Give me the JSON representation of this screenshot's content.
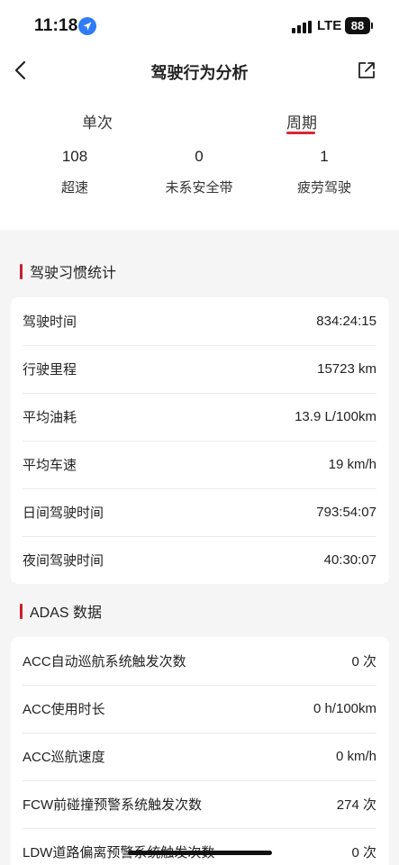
{
  "status_bar": {
    "time": "11:18",
    "network": "LTE",
    "battery": "88",
    "location_icon": "location-arrow-icon",
    "signal_icon": "signal-bars-icon"
  },
  "header": {
    "title": "驾驶行为分析",
    "back_icon": "chevron-left-icon",
    "share_icon": "external-link-icon"
  },
  "tabs": [
    {
      "label": "单次",
      "active": false
    },
    {
      "label": "周期",
      "active": true
    }
  ],
  "accent_color": "#d9263b",
  "stats": [
    {
      "value": "108",
      "label": "超速"
    },
    {
      "value": "0",
      "label": "未系安全带"
    },
    {
      "value": "1",
      "label": "疲劳驾驶"
    }
  ],
  "habits": {
    "title": "驾驶习惯统计",
    "rows": [
      {
        "label": "驾驶时间",
        "value": "834:24:15"
      },
      {
        "label": "行驶里程",
        "value": "15723 km"
      },
      {
        "label": "平均油耗",
        "value": "13.9 L/100km"
      },
      {
        "label": "平均车速",
        "value": "19 km/h"
      },
      {
        "label": "日间驾驶时间",
        "value": "793:54:07"
      },
      {
        "label": "夜间驾驶时间",
        "value": "40:30:07"
      }
    ]
  },
  "adas": {
    "title": "ADAS 数据",
    "rows": [
      {
        "label": "ACC自动巡航系统触发次数",
        "value": "0 次"
      },
      {
        "label": "ACC使用时长",
        "value": "0 h/100km"
      },
      {
        "label": "ACC巡航速度",
        "value": "0 km/h"
      },
      {
        "label": "FCW前碰撞预警系统触发次数",
        "value": "274 次"
      },
      {
        "label": "LDW道路偏离预警系统触发次数",
        "value": "0 次"
      }
    ]
  }
}
